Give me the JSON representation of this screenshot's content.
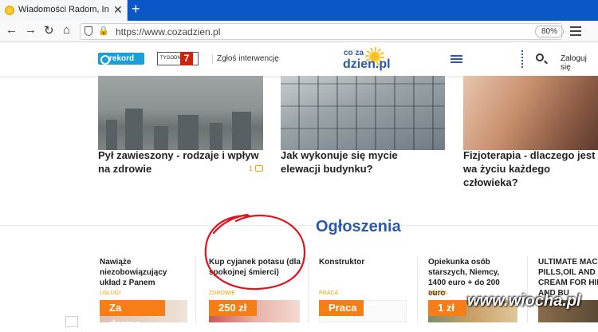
{
  "browser": {
    "tab_title": "Wiadomości Radom, Informac",
    "url": "https://www.cozadzien.pl",
    "zoom": "80%"
  },
  "header": {
    "rekord_label": "rekord",
    "tygodnik_label": "TYGODNIK",
    "tygodnik_number": "7",
    "report_link": "Zgłoś interwencję",
    "logo_top": "co za",
    "logo_main": "dzien.pl",
    "login": "Zaloguj się"
  },
  "articles": [
    {
      "title": "Pył zawieszony - rodzaje i wpływ na zdrowie",
      "comments": "1"
    },
    {
      "title": "Jak wykonuje się mycie elewacji budynku?"
    },
    {
      "title": "Fizjoterapia - dlaczego jest wa życiu każdego człowieka?"
    }
  ],
  "classifieds": {
    "heading": "Ogłoszenia",
    "items": [
      {
        "title": "Nawiąże niezobowiązujący układ z Panem",
        "category": "USŁUGI",
        "price": "Za darmo"
      },
      {
        "title": "Kup cyjanek potasu (dla spokojnej śmierci)",
        "category": "ZDROWIE",
        "price": "250 zł"
      },
      {
        "title": "Konstruktor",
        "category": "PRACA",
        "price": "Praca"
      },
      {
        "title": "Opiekunka osób starszych, Niemcy, 1400 euro + do 200 euro",
        "category": "PRACA",
        "price": "1 zł"
      },
      {
        "title": "ULTIMATE MACA PILLS,OIL AND CREAM FOR HIPS AND BU"
      }
    ]
  },
  "watermark": "www.wiocha.pl",
  "colors": {
    "brand_blue": "#2a5aa8",
    "accent_orange": "#f57e16",
    "annotation_red": "#e0141c"
  }
}
